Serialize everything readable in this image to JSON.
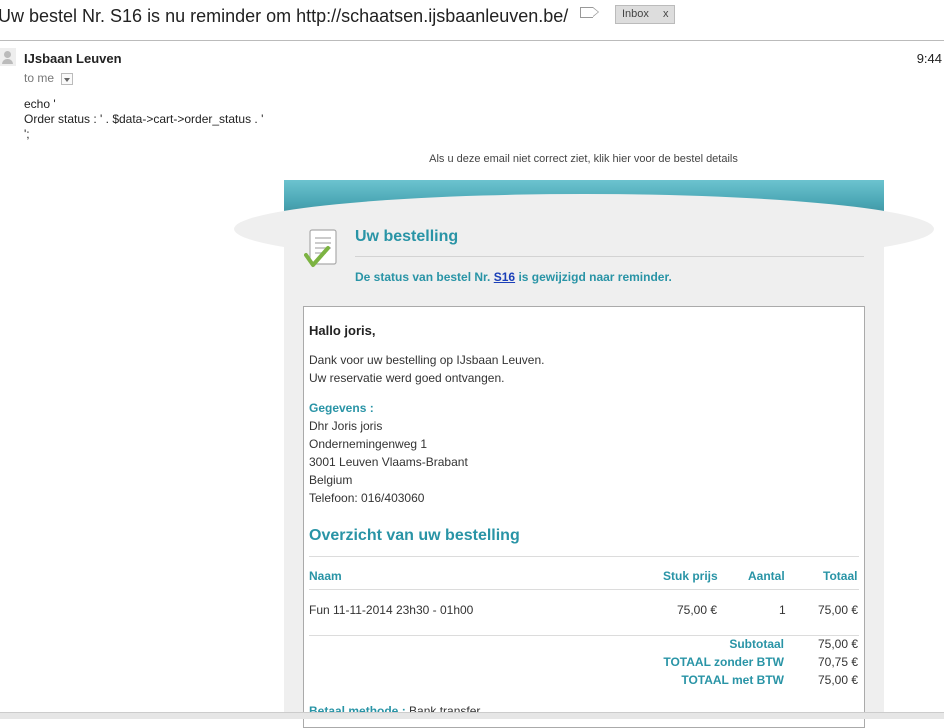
{
  "header": {
    "subject": "Uw bestel Nr. S16 is nu reminder om http://schaatsen.ijsbaanleuven.be/",
    "inbox_label": "Inbox",
    "inbox_close": "x"
  },
  "message": {
    "sender": "IJsbaan Leuven",
    "time": "9:44",
    "to_me": "to me",
    "code_lines": [
      "echo '",
      "Order status : ' . $data->cart->order_status . '",
      "';"
    ],
    "view_link": "Als u deze email niet correct ziet, klik hier voor de bestel details"
  },
  "email": {
    "title": "Uw bestelling",
    "status_prefix": "De status van bestel Nr.",
    "order_no": "S16",
    "status_suffix": "is gewijzigd naar reminder.",
    "greeting": "Hallo joris,",
    "thanks_1": "Dank voor uw bestelling op IJsbaan Leuven.",
    "thanks_2": "Uw reservatie werd goed ontvangen.",
    "details_label": "Gegevens :",
    "details": [
      "Dhr Joris joris",
      "Ondernemingenweg 1",
      "3001 Leuven Vlaams-Brabant",
      "Belgium",
      "Telefoon: 016/403060"
    ],
    "overview_title": "Overzicht van uw bestelling",
    "columns": {
      "name": "Naam",
      "unit_price": "Stuk prijs",
      "qty": "Aantal",
      "total": "Totaal"
    },
    "item": {
      "name": "Fun 11-11-2014 23h30 - 01h00",
      "unit_price": "75,00 €",
      "qty": "1",
      "total": "75,00 €"
    },
    "totals": [
      {
        "label": "Subtotaal",
        "value": "75,00 €"
      },
      {
        "label": "TOTAAL zonder BTW",
        "value": "70,75 €"
      },
      {
        "label": "TOTAAL met BTW",
        "value": "75,00 €"
      }
    ],
    "payment_label": "Betaal methode :",
    "payment_value": "Bank transfer"
  }
}
